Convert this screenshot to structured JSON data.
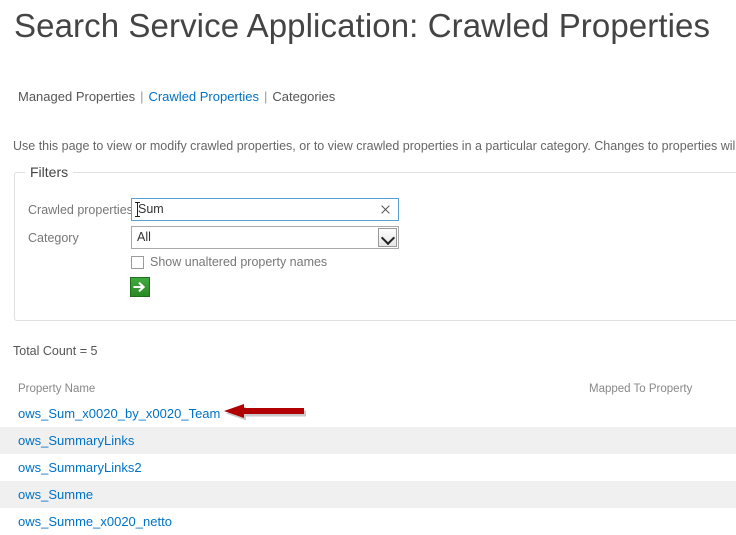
{
  "header": {
    "title": "Search Service Application: Crawled Properties"
  },
  "nav": {
    "separator": "|",
    "items": [
      {
        "label": "Managed Properties",
        "active": false
      },
      {
        "label": "Crawled Properties",
        "active": true
      },
      {
        "label": "Categories",
        "active": false
      }
    ]
  },
  "description": {
    "text": "Use this page to view or modify crawled properties, or to view crawled properties in a particular category. Changes to properties will take eff"
  },
  "filters": {
    "legend": "Filters",
    "crawled_properties": {
      "label": "Crawled properties",
      "value": "Sum",
      "placeholder": "",
      "clear_icon": "close-x-icon"
    },
    "category": {
      "label": "Category",
      "value": "All",
      "options": [
        "All"
      ],
      "chevron_icon": "chevron-down-icon"
    },
    "show_unaltered": {
      "label": "Show unaltered property names",
      "checked": false
    },
    "submit": {
      "icon": "arrow-right-icon",
      "color": "#2f9e2f"
    }
  },
  "results": {
    "total_count_text": "Total Count = 5",
    "columns": {
      "property_name": "Property Name",
      "mapped_to_property": "Mapped To Property"
    },
    "rows": [
      {
        "property_name": "ows_Sum_x0020_by_x0020_Team",
        "mapped_to_property": ""
      },
      {
        "property_name": "ows_SummaryLinks",
        "mapped_to_property": ""
      },
      {
        "property_name": "ows_SummaryLinks2",
        "mapped_to_property": ""
      },
      {
        "property_name": "ows_Summe",
        "mapped_to_property": ""
      },
      {
        "property_name": "ows_Summe_x0020_netto",
        "mapped_to_property": ""
      }
    ]
  },
  "annotation": {
    "arrow_icon": "arrow-left-icon",
    "color": "#b00000",
    "points_at_row_index": 0
  },
  "colors": {
    "link_blue": "#0072c6",
    "title_gray": "#444444",
    "alt_row_gray": "#f0f0f0",
    "annotation_red": "#b00000",
    "go_green": "#2f9e2f",
    "focus_border_blue": "#5a9fd4"
  }
}
